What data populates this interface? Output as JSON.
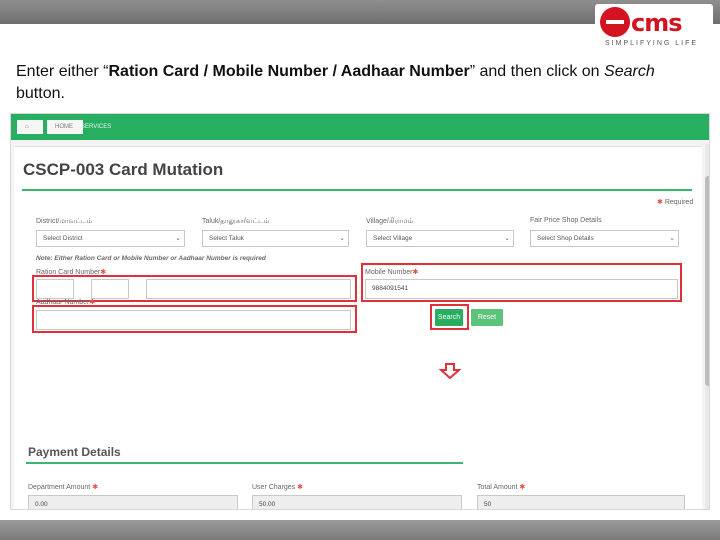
{
  "colors": {
    "brand_red": "#d3131f",
    "accent_green": "#27ae60",
    "highlight_red": "#e0303a"
  },
  "logo": {
    "text": "cms",
    "tagline": "SIMPLIFYING LIFE"
  },
  "instruction": {
    "part1": "Enter either “",
    "bold_part": "Ration Card / Mobile Number / Aadhaar Number",
    "part2": "” and then click on ",
    "italic_part": "Search",
    "part3": " button."
  },
  "breadcrumb": {
    "home_icon": "home-icon",
    "home": "HOME",
    "services": "SERVICES"
  },
  "page": {
    "title": "CSCP-003 Card Mutation",
    "required_note": "Required"
  },
  "filters": {
    "district": {
      "label": "District/மாவட்டம்",
      "value": "Select District"
    },
    "taluk": {
      "label": "Taluk/தாலுகா/வட்டம்",
      "value": "Select Taluk"
    },
    "village": {
      "label": "Village/கிராமம்",
      "value": "Select Village"
    },
    "shop": {
      "label": "Fair Price Shop Details",
      "value": "Select Shop Details"
    }
  },
  "note": "Note: Either Ration Card or Mobile Number or Aadhaar Number is required",
  "ration_card": {
    "label": "Ration Card Number"
  },
  "aadhaar": {
    "label": "Aadhaar Number"
  },
  "mobile": {
    "label": "Mobile Number",
    "value": "9884091541"
  },
  "buttons": {
    "search": "Search",
    "reset": "Reset"
  },
  "payment": {
    "title": "Payment Details",
    "department_amount": {
      "label": "Department Amount",
      "value": "0.00"
    },
    "user_charges": {
      "label": "User Charges",
      "value": "50.00"
    },
    "total_amount": {
      "label": "Total Amount",
      "value": "50"
    }
  }
}
